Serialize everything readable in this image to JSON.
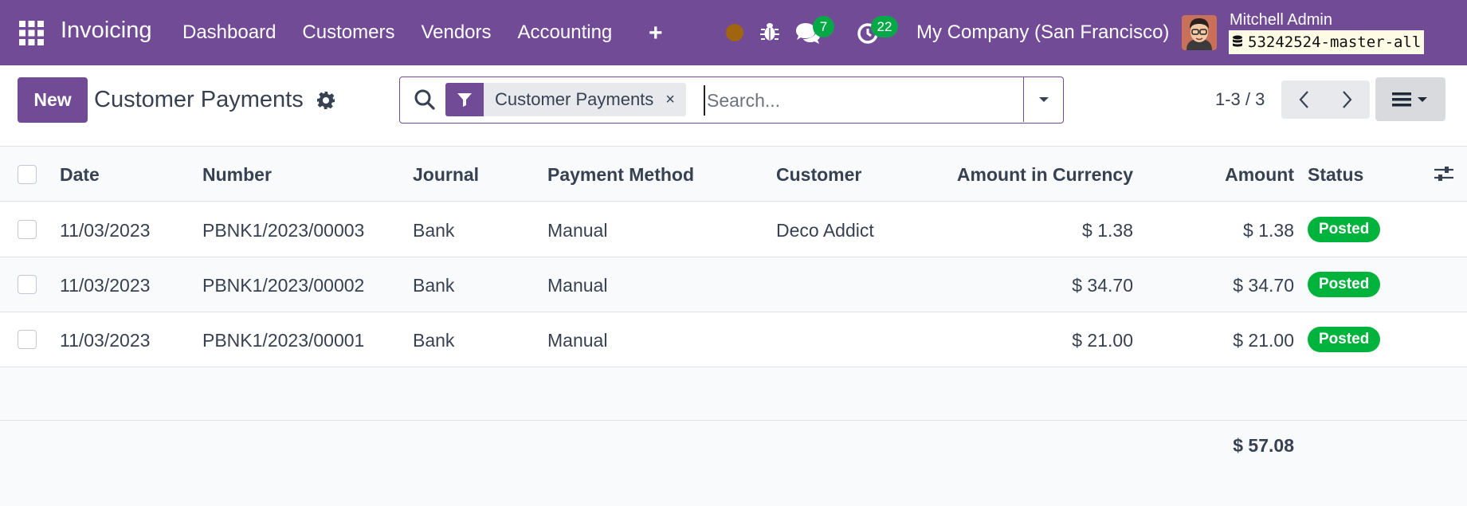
{
  "navbar": {
    "app_name": "Invoicing",
    "menu": [
      "Dashboard",
      "Customers",
      "Vendors",
      "Accounting"
    ],
    "chat_count": "7",
    "activity_count": "22",
    "company": "My Company (San Francisco)",
    "user_name": "Mitchell Admin",
    "database": "53242524-master-all",
    "brand_color": "#714B96"
  },
  "control_panel": {
    "new_label": "New",
    "title": "Customer Payments",
    "facet_label": "Customer Payments",
    "facet_remove": "×",
    "search_placeholder": "Search...",
    "pager": "1-3 / 3"
  },
  "table": {
    "columns": [
      "Date",
      "Number",
      "Journal",
      "Payment Method",
      "Customer",
      "Amount in Currency",
      "Amount",
      "Status"
    ],
    "rows": [
      {
        "date": "11/03/2023",
        "number": "PBNK1/2023/00003",
        "journal": "Bank",
        "method": "Manual",
        "customer": "Deco Addict",
        "amount_currency": "$ 1.38",
        "amount": "$ 1.38",
        "status": "Posted"
      },
      {
        "date": "11/03/2023",
        "number": "PBNK1/2023/00002",
        "journal": "Bank",
        "method": "Manual",
        "customer": "",
        "amount_currency": "$ 34.70",
        "amount": "$ 34.70",
        "status": "Posted"
      },
      {
        "date": "11/03/2023",
        "number": "PBNK1/2023/00001",
        "journal": "Bank",
        "method": "Manual",
        "customer": "",
        "amount_currency": "$ 21.00",
        "amount": "$ 21.00",
        "status": "Posted"
      }
    ],
    "total_amount": "$ 57.08",
    "status_color": "#00b33c"
  }
}
